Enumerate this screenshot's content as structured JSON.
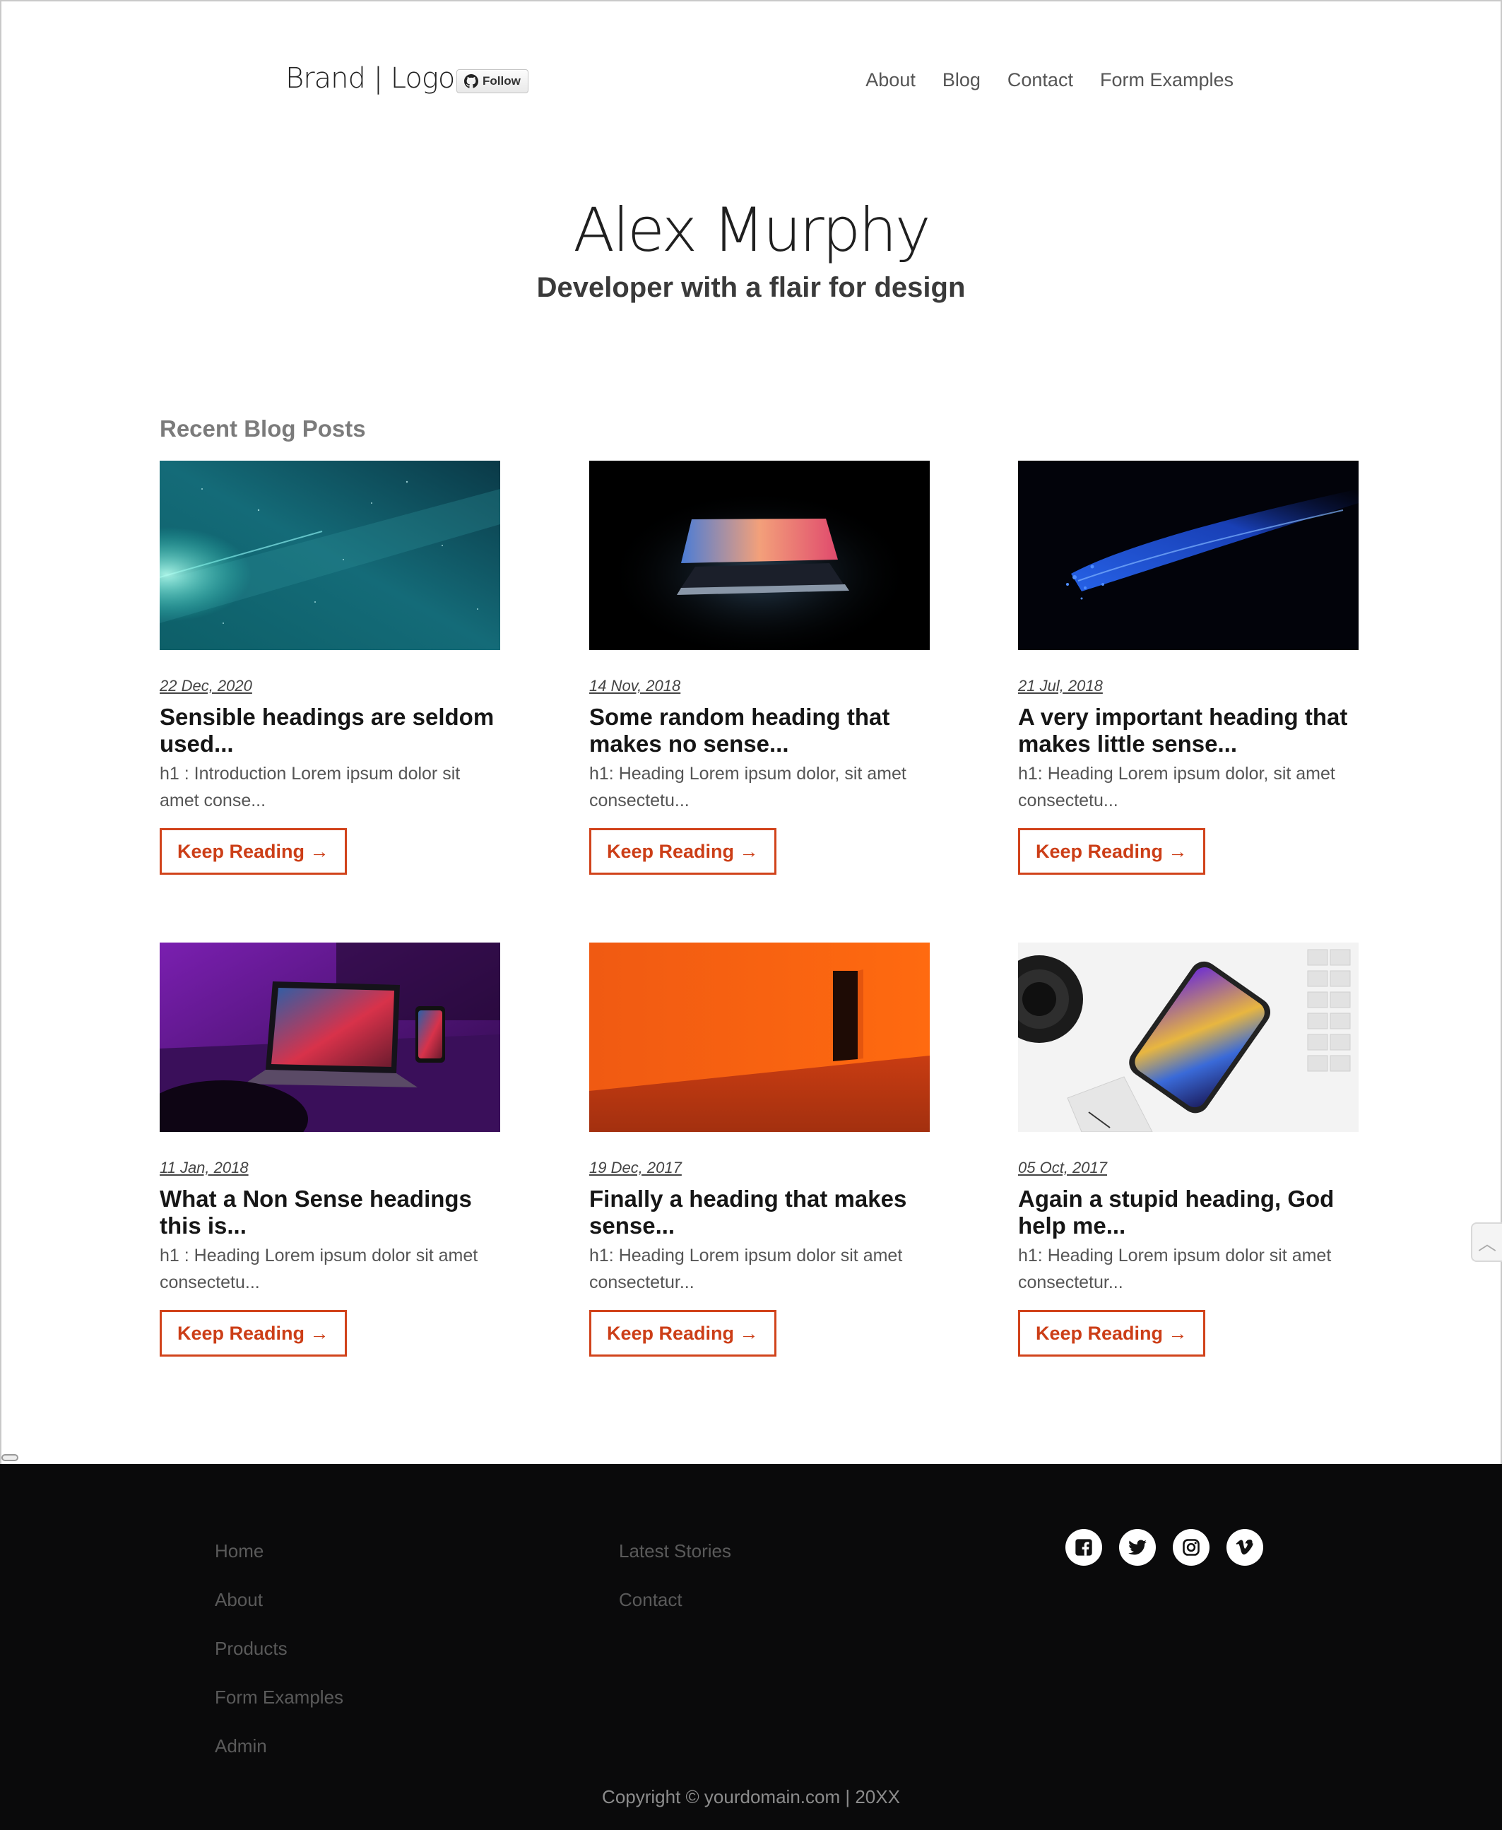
{
  "header": {
    "brand": "Brand | Logo",
    "follow_label": "Follow",
    "nav": [
      "About",
      "Blog",
      "Contact",
      "Form Examples"
    ]
  },
  "hero": {
    "name": "Alex Murphy",
    "tagline": "Developer with a flair for design"
  },
  "posts_section": {
    "title": "Recent Blog Posts",
    "button_label": "Keep Reading →",
    "posts": [
      {
        "date": "22 Dec, 2020",
        "title": "Sensible headings are seldom used...",
        "excerpt": "h1 : Introduction Lorem ipsum dolor sit amet conse..."
      },
      {
        "date": "14 Nov, 2018",
        "title": "Some random heading that makes no sense...",
        "excerpt": "h1: Heading Lorem ipsum dolor, sit amet consectetu..."
      },
      {
        "date": "21 Jul, 2018",
        "title": "A very important heading that makes little sense...",
        "excerpt": "h1: Heading Lorem ipsum dolor, sit amet consectetu..."
      },
      {
        "date": "11 Jan, 2018",
        "title": "What a Non Sense headings this is...",
        "excerpt": "h1 : Heading Lorem ipsum dolor sit amet consectetu..."
      },
      {
        "date": "19 Dec, 2017",
        "title": "Finally a heading that makes sense...",
        "excerpt": "h1: Heading Lorem ipsum dolor sit amet consectetur..."
      },
      {
        "date": "05 Oct, 2017",
        "title": "Again a stupid heading, God help me...",
        "excerpt": "h1: Heading Lorem ipsum dolor sit amet consectetur..."
      }
    ]
  },
  "footer": {
    "col1": [
      "Home",
      "About",
      "Products",
      "Form Examples",
      "Admin"
    ],
    "col2": [
      "Latest Stories",
      "Contact"
    ],
    "socials": [
      "facebook-icon",
      "twitter-icon",
      "instagram-icon",
      "vimeo-icon"
    ],
    "copyright": "Copyright © yourdomain.com | 20XX"
  },
  "colors": {
    "accent": "#d1431b",
    "footer_bg": "#0a0a0b"
  }
}
